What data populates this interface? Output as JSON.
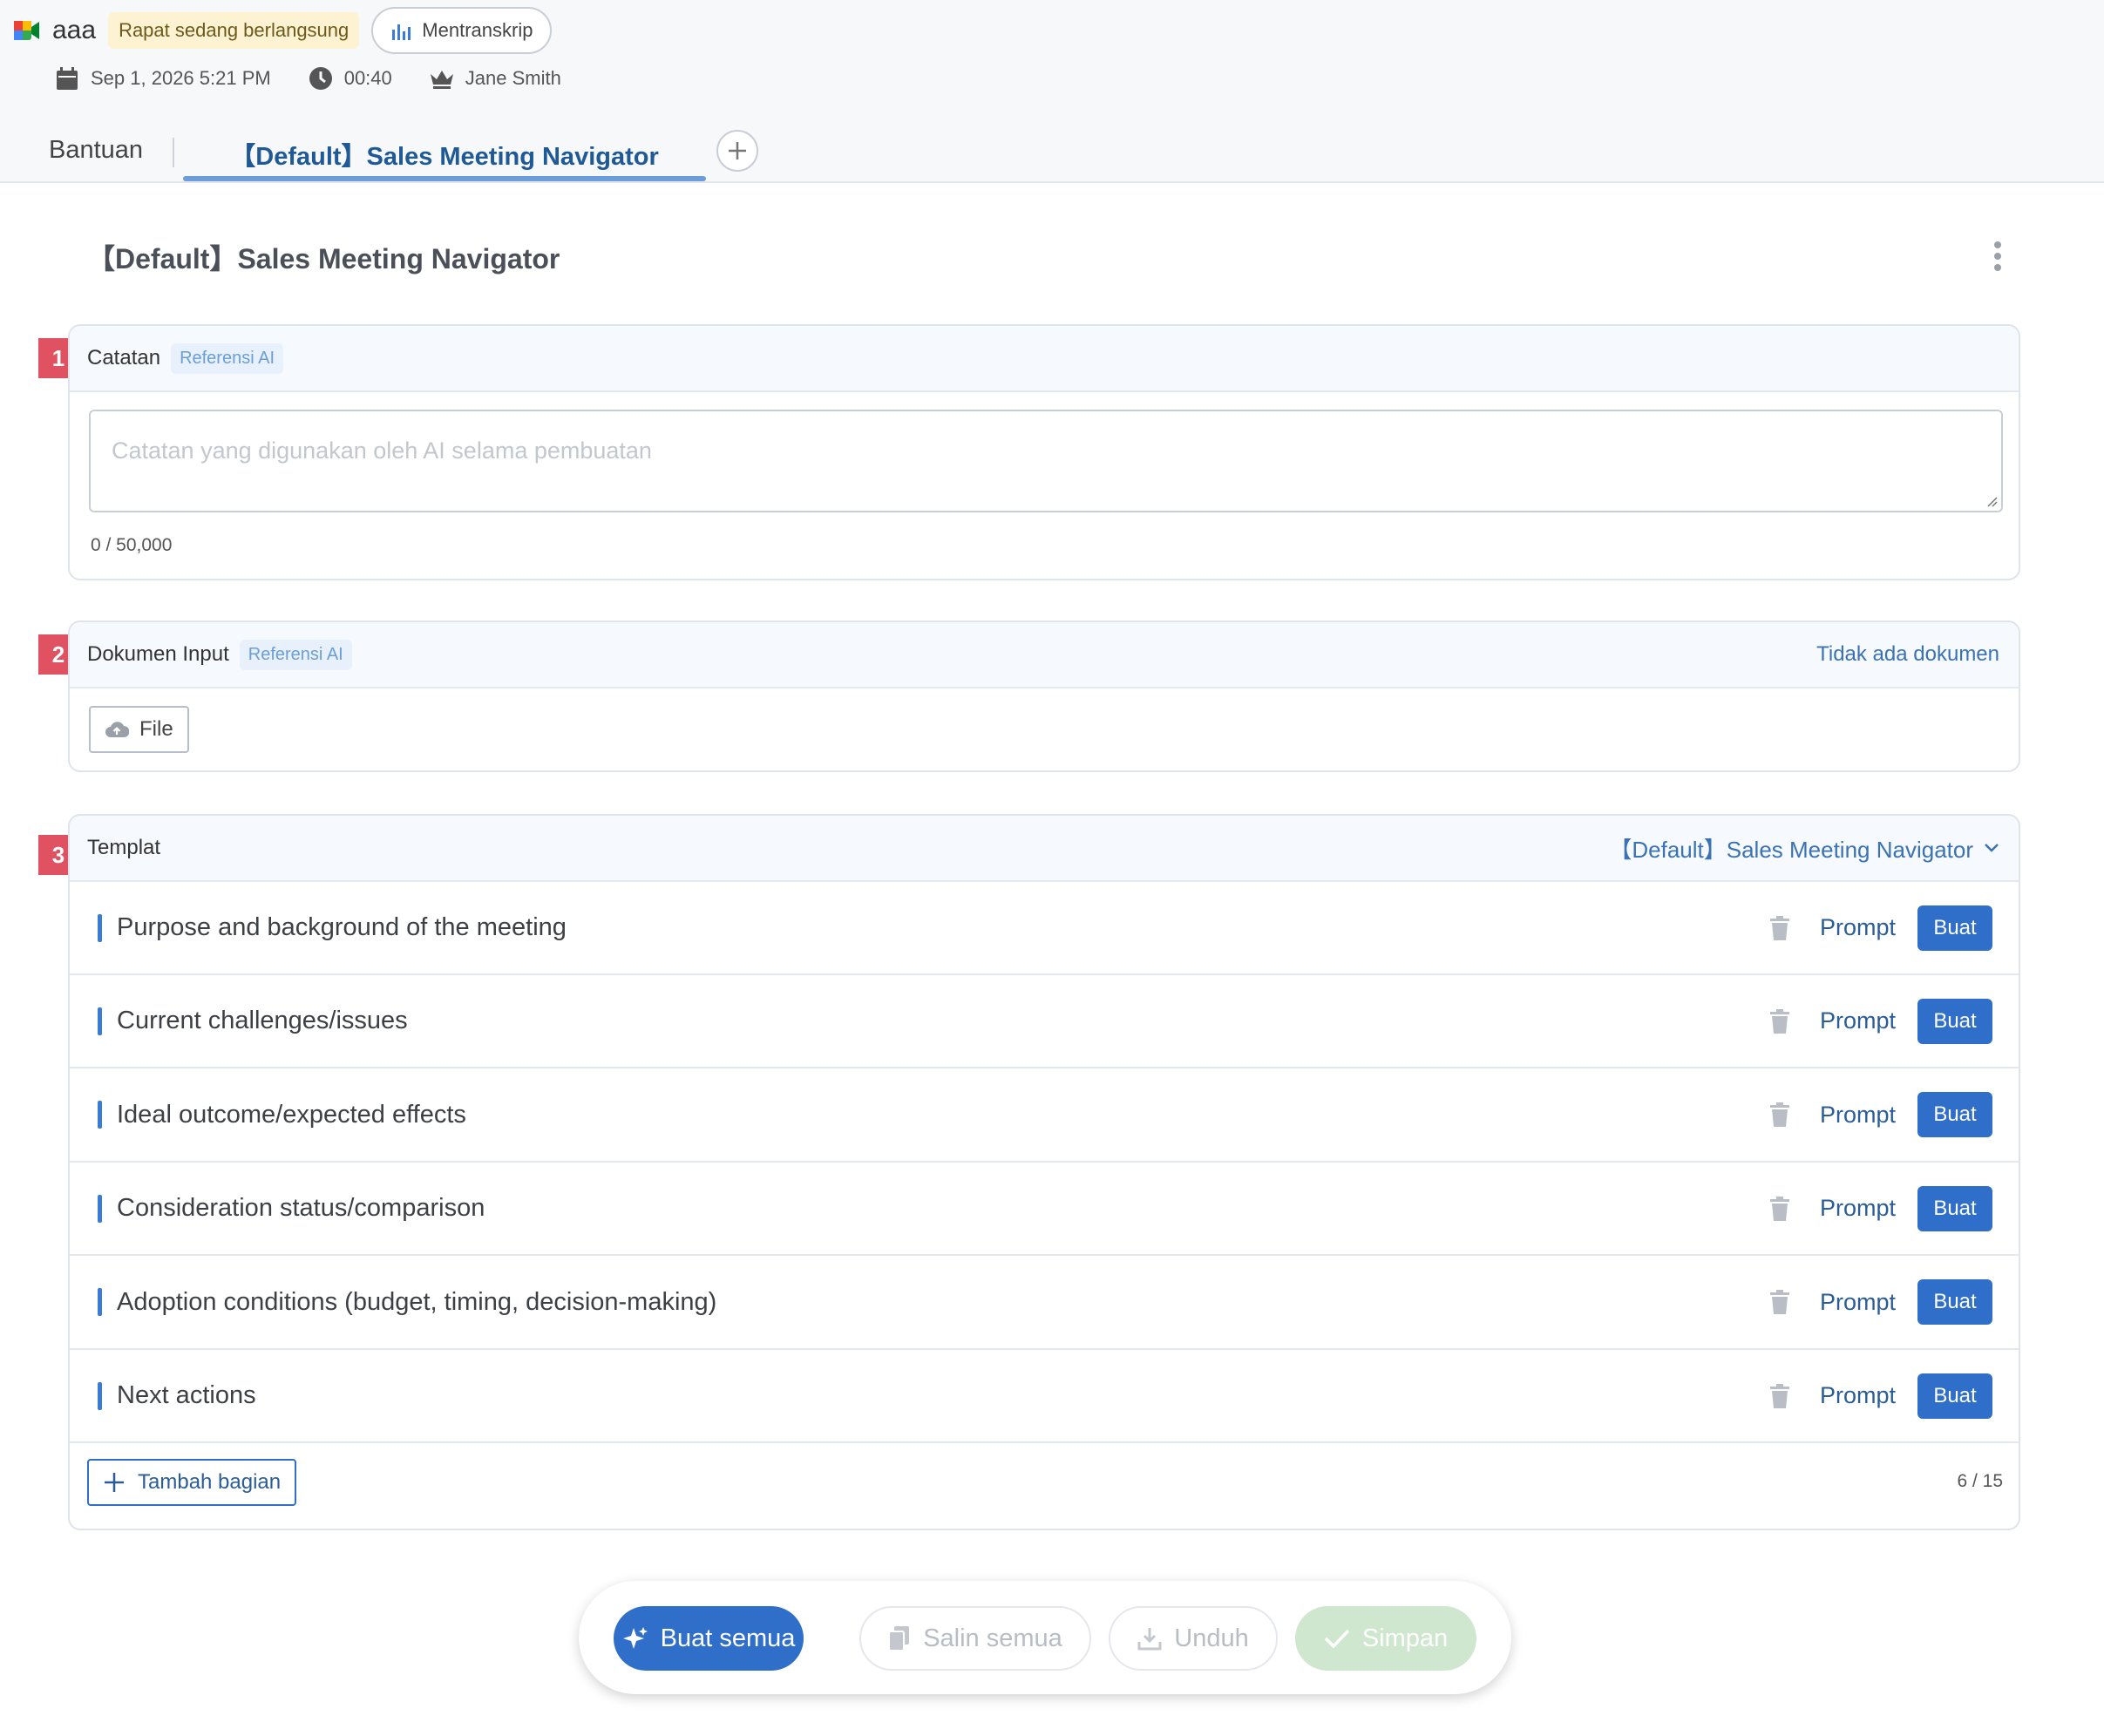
{
  "header": {
    "app_title": "aaa",
    "status": "Rapat sedang berlangsung",
    "transcribe_label": "Mentranskrip",
    "date": "Sep 1, 2026 5:21 PM",
    "duration": "00:40",
    "owner": "Jane Smith"
  },
  "tabs": {
    "help": "Bantuan",
    "active": "【Default】Sales Meeting Navigator"
  },
  "page": {
    "title": "【Default】Sales Meeting Navigator"
  },
  "notes": {
    "number": "1",
    "label": "Catatan",
    "chip": "Referensi AI",
    "placeholder": "Catatan yang digunakan oleh AI selama pembuatan",
    "counter": "0 / 50,000"
  },
  "documents": {
    "number": "2",
    "label": "Dokumen Input",
    "chip": "Referensi AI",
    "status": "Tidak ada dokumen",
    "file_label": "File"
  },
  "template": {
    "number": "3",
    "label": "Templat",
    "selected": "【Default】Sales Meeting Navigator",
    "prompt_label": "Prompt",
    "make_label": "Buat",
    "sections": [
      "Purpose and background of the meeting",
      "Current challenges/issues",
      "Ideal outcome/expected effects",
      "Consideration status/comparison",
      "Adoption conditions (budget, timing, decision-making)",
      "Next actions"
    ],
    "add_label": "Tambah bagian",
    "count": "6 / 15"
  },
  "actions": {
    "generate_all": "Buat semua",
    "copy_all": "Salin semua",
    "download": "Unduh",
    "save": "Simpan"
  },
  "colors": {
    "primary": "#2f6ec9",
    "badge": "#e05262",
    "status_bg": "#fdf3d3",
    "save_disabled": "#cfe6cf"
  }
}
